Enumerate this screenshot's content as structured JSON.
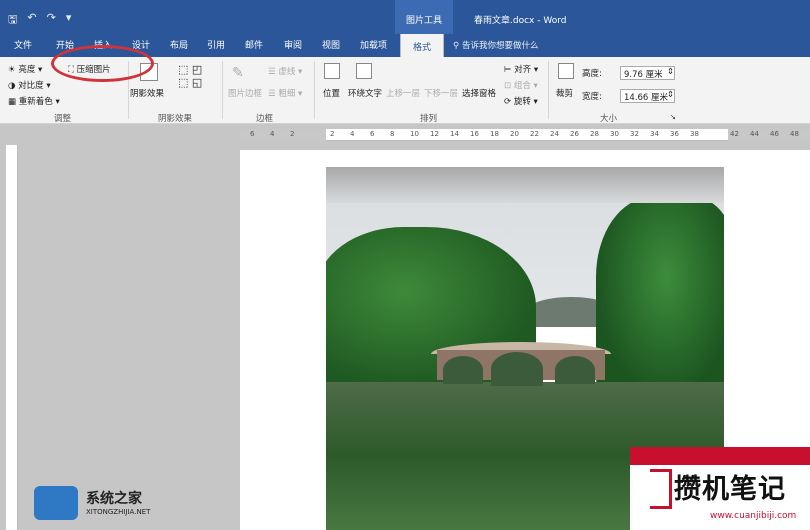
{
  "titlebar": {
    "context_tool": "图片工具",
    "document_title": "春雨文章.docx - Word",
    "qat": [
      "🖫",
      "↶",
      "↷",
      "▾"
    ]
  },
  "tabs": [
    "文件",
    "开始",
    "插入",
    "设计",
    "布局",
    "引用",
    "邮件",
    "审阅",
    "视图",
    "加载项",
    "格式"
  ],
  "tell_me": "告诉我你想要做什么",
  "ribbon": {
    "adjust": {
      "brightness": "亮度",
      "contrast": "对比度",
      "recolor": "重新着色",
      "compress": "压缩图片",
      "label": "调整"
    },
    "shadow": {
      "shadow_effect": "阴影效果",
      "label": "阴影效果"
    },
    "border": {
      "picture_border": "图片边框",
      "dim1": "虚线",
      "dim2": "粗细",
      "label": "边框"
    },
    "arrange": {
      "position": "位置",
      "wrap": "环绕文字",
      "bring_forward": "上移一层",
      "send_backward": "下移一层",
      "selection_pane": "选择窗格",
      "align": "对齐",
      "group": "组合",
      "rotate": "旋转",
      "label": "排列"
    },
    "size": {
      "crop": "裁剪",
      "height_label": "高度:",
      "height_value": "9.76 厘米",
      "width_label": "宽度:",
      "width_value": "14.66 厘米",
      "label": "大小"
    }
  },
  "ruler": {
    "ticks": [
      "6",
      "4",
      "2",
      "",
      "2",
      "4",
      "6",
      "8",
      "10",
      "12",
      "14",
      "16",
      "18",
      "20",
      "22",
      "24",
      "26",
      "28",
      "30",
      "32",
      "34",
      "36",
      "38",
      "",
      "42",
      "44",
      "46",
      "48"
    ]
  },
  "watermarks": {
    "left_title": "系统之家",
    "left_sub": "XITONGZHIJIA.NET",
    "right_title": "攒机笔记",
    "right_sub": "www.cuanjibiji.com"
  },
  "colors": {
    "word_blue": "#2b579a",
    "annotation_red": "#d0333a"
  }
}
